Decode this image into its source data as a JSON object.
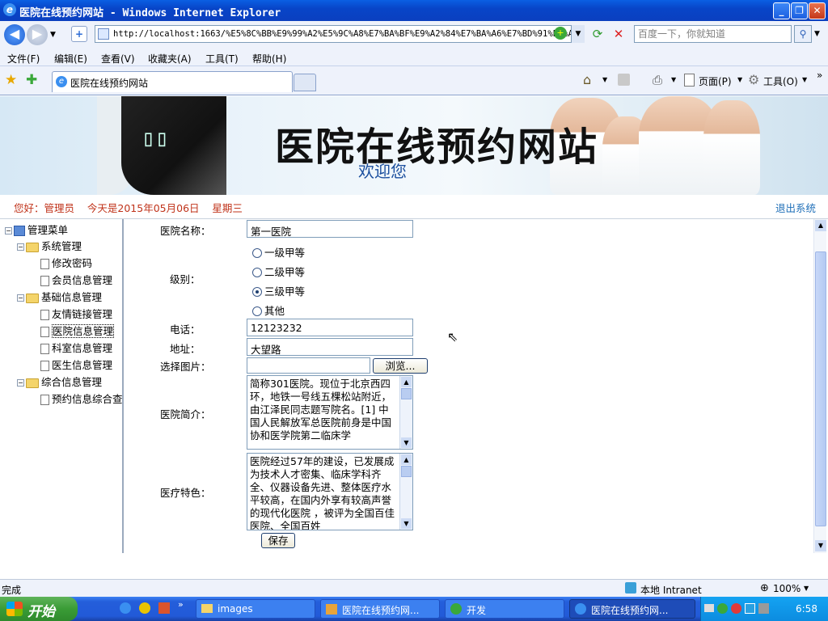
{
  "window": {
    "title": "医院在线预约网站 - Windows Internet Explorer"
  },
  "address": {
    "url": "http://localhost:1663/%E5%8C%BB%E9%99%A2%E5%9C%A8%E7%BA%BF%E9%A2%84%E7%BA%A6%E7%BD%91%E7%AB",
    "search_placeholder": "百度一下，你就知道"
  },
  "menu": [
    "文件(F)",
    "编辑(E)",
    "查看(V)",
    "收藏夹(A)",
    "工具(T)",
    "帮助(H)"
  ],
  "tab": {
    "label": "医院在线预约网站"
  },
  "toolbar": {
    "page_label": "页面(P)",
    "tools_label": "工具(O)"
  },
  "banner": {
    "title": "医院在线预约网站",
    "subtitle": "欢迎您"
  },
  "info": {
    "greeting": "您好：管理员    今天是2015年05月06日    星期三",
    "logout": "退出系统"
  },
  "sidebar": {
    "root": "管理菜单",
    "groups": [
      {
        "label": "系统管理",
        "items": [
          "修改密码",
          "会员信息管理"
        ]
      },
      {
        "label": "基础信息管理",
        "items": [
          "友情链接管理",
          "医院信息管理",
          "科室信息管理",
          "医生信息管理"
        ]
      },
      {
        "label": "综合信息管理",
        "items": [
          "预约信息综合查"
        ]
      }
    ]
  },
  "form": {
    "name_label": "医院名称：",
    "name_value": "第一医院",
    "level_label": "级别：",
    "levels": [
      "一级甲等",
      "二级甲等",
      "三级甲等",
      "其他"
    ],
    "level_selected": "三级甲等",
    "phone_label": "电话：",
    "phone_value": "12123232",
    "address_label": "地址：",
    "address_value": "大望路",
    "image_label": "选择图片：",
    "browse_label": "浏览...",
    "intro_label": "医院简介：",
    "intro_text": "简称301医院。现位于北京西四环，地铁一号线五棵松站附近，由江泽民同志题写院名。[1] 中国人民解放军总医院前身是中国协和医学院第二临床学",
    "feature_label": "医疗特色：",
    "feature_text": "医院经过57年的建设，已发展成为技术人才密集、临床学科齐全、仪器设备先进、整体医疗水平较高，在国内外享有较高声誉的现代化医院 ，被评为全国百佳医院、全国百姓",
    "save_label": "保存"
  },
  "status": {
    "text": "完成",
    "zone": "本地 Intranet",
    "zoom": "100%"
  },
  "taskbar": {
    "start": "开始",
    "tasks": [
      "images",
      "医院在线预约网...",
      "开发",
      "医院在线预约网..."
    ],
    "time": "6:58"
  }
}
